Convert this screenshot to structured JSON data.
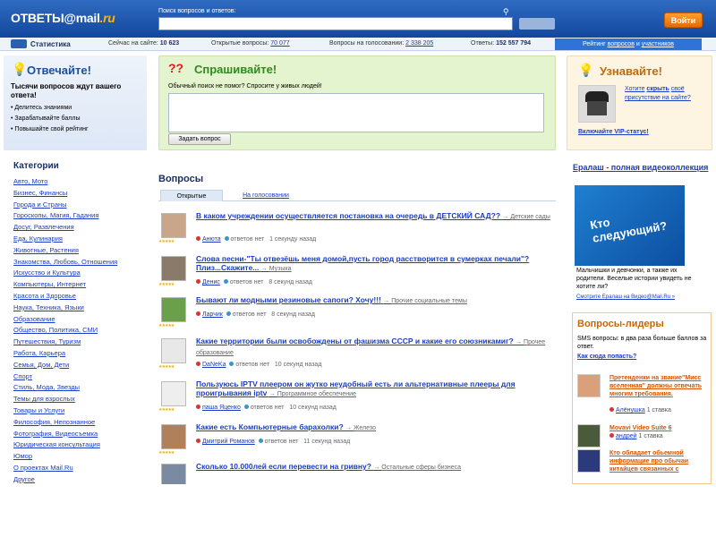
{
  "header": {
    "logo_text": "ОТВЕТЫ@mail.ru",
    "logo_main": "ОТВЕТЫ",
    "logo_at": "@",
    "logo_mail": "mail",
    "logo_ru": ".ru",
    "search_label": "Поиск вопросов и ответов:",
    "search_value": "",
    "login_label": "Войти"
  },
  "stats": {
    "label": "Статистика",
    "online_label": "Сейчас на сайте:",
    "online_value": "10 623",
    "open_label": "Открытые вопросы:",
    "open_value": "70 077",
    "voting_label": "Вопросы на голосовании:",
    "voting_value": "2 338 205",
    "answers_label": "Ответы:",
    "answers_value": "152 557 794",
    "rating_prefix": "Рейтинг",
    "rating_questions": "вопросов",
    "rating_and": "и",
    "rating_participants": "участников"
  },
  "answer_box": {
    "title": "Отвечайте!",
    "subtitle": "Тысячи вопросов ждут вашего ответа!",
    "items": [
      "Делитесь знаниями",
      "Зарабатывайте баллы",
      "Повышайте свой рейтинг"
    ]
  },
  "ask_box": {
    "title": "Спрашивайте!",
    "hint": "Обычный поиск не помог? Спросите у живых людей!",
    "button": "Задать вопрос"
  },
  "learn_box": {
    "title": "Узнавайте!",
    "text_pre": "Хотите",
    "text_link": "скрыть",
    "text_post": "своё присутствие на сайте?",
    "vip": "Включайте VIP-статус!"
  },
  "categories": {
    "title": "Категории",
    "items": [
      "Авто, Мото",
      "Бизнес, Финансы",
      "Города и Страны",
      "Гороскопы, Магия, Гадания",
      "Досуг, Развлечения",
      "Еда, Кулинария",
      "Животные, Растения",
      "Знакомства, Любовь, Отношения",
      "Искусство и Культура",
      "Компьютеры, Интернет",
      "Красота и Здоровье",
      "Наука, Техника, Языки",
      "Образование",
      "Общество, Политика, СМИ",
      "Путешествия, Туризм",
      "Работа, Карьера",
      "Семья, Дом, Дети",
      "Спорт",
      "Стиль, Мода, Звезды",
      "Темы для взрослых",
      "Товары и Услуги",
      "Философия, Непознанное",
      "Фотография, Видеосъемка",
      "Юридическая консультация",
      "Юмор",
      "О проектах Mail.Ru",
      "Другое"
    ]
  },
  "questions": {
    "title": "Вопросы",
    "tab_open": "Открытые",
    "tab_voting": "На голосовании",
    "items": [
      {
        "title": "В каком учреждении осуществляется постановка на очередь в ДЕТСКИЙ САД??",
        "category": "Детские сады",
        "user": "Анюта",
        "answers": "ответов нет",
        "time": "1 секунду назад"
      },
      {
        "title": "Слова песни-\"Ты отвезёшь меня домой,пусть город расстворится в сумерках печали\"? Плиз...Скажите...",
        "category": "Музыка",
        "user": "Денис",
        "answers": "ответов нет",
        "time": "8 секунд назад"
      },
      {
        "title": "Бывают ли модными резиновые сапоги? Хочу!!!",
        "category": "Прочие социальные темы",
        "user": "Ларчик",
        "answers": "ответов нет",
        "time": "8 секунд назад"
      },
      {
        "title": "Какие территории были освобождены от фашизма СССР и какие его союзникамиг?",
        "category": "Прочее образование",
        "user": "DaNeKa",
        "answers": "ответов нет",
        "time": "10 секунд назад"
      },
      {
        "title": "Пользуюсь IPTV плеером он жутко неудобный есть ли альтернативные плееры для проигрывания iptv",
        "category": "Программное обеспечение",
        "user": "паша Яценко",
        "answers": "ответов нет",
        "time": "10 секунд назад"
      },
      {
        "title": "Какие есть Компьютерные барахолки?",
        "category": "Железо",
        "user": "Дмитрий Романов",
        "answers": "ответов нет",
        "time": "11 секунд назад"
      },
      {
        "title": "Сколько 10.000лей если перевести на гривну?",
        "category": "Остальные сферы бизнеса",
        "user": "",
        "answers": "",
        "time": ""
      }
    ]
  },
  "ad": {
    "title": "Ералаш - полная видеоколлекция",
    "image_text": "Кто следующий?",
    "desc": "Мальчишки и девчонки, а также их родители. Веселые истории увидеть не хотите ли?",
    "small": "Смотрите Ералаш на Видео@Mail.Ru »"
  },
  "leaders": {
    "title": "Вопросы-лидеры",
    "sms": "SMS вопросы: в два раза больше баллов за ответ.",
    "how": "Как сюда попасть?",
    "items": [
      {
        "title": "Претенденки на звание\"Мисс вселенная\" должны отвечать многим требования.",
        "user": "Алёнушка",
        "stakes": "1 ставка"
      },
      {
        "title": "Movavi Video Suite 6",
        "user": "андрей",
        "stakes": "1 ставка"
      },
      {
        "title": "Кто обладает обьемной информацие про обычаи китайцев связанных с",
        "user": "",
        "stakes": ""
      }
    ]
  }
}
